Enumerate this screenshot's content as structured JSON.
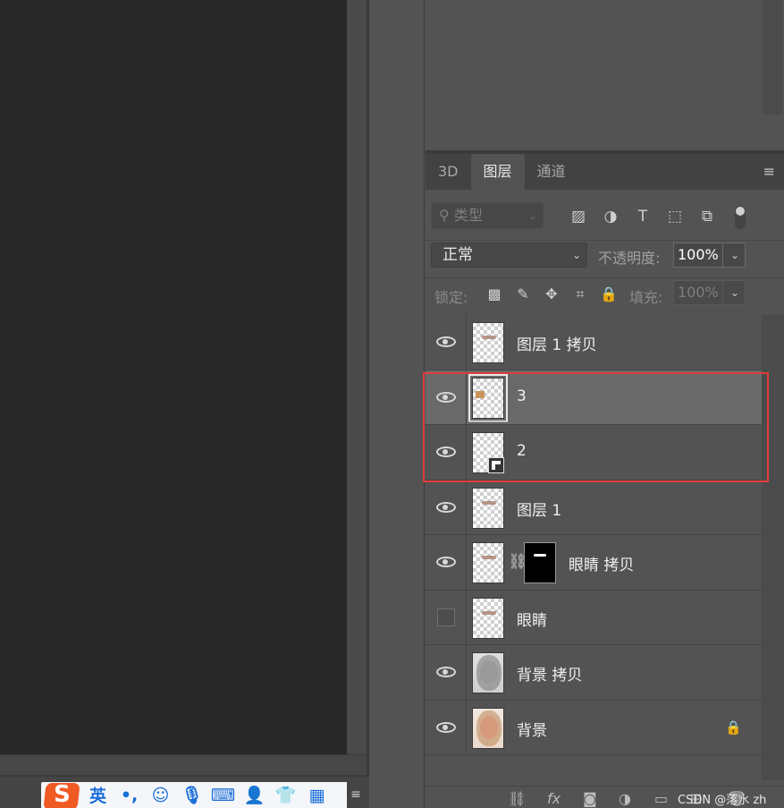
{
  "ime": {
    "logo": "S",
    "mode": "英",
    "punct": "•,",
    "buttons": [
      "emoji-icon",
      "microphone-icon",
      "keyboard-icon",
      "user-icon",
      "skin-icon",
      "toolbox-icon"
    ],
    "menu": "≡"
  },
  "panel": {
    "tabs": [
      "3D",
      "图层",
      "通道"
    ],
    "active_tab": "图层",
    "menu_icon": "≡"
  },
  "filter": {
    "search_label": "类型",
    "icons": [
      "image-filter-icon",
      "adjustment-filter-icon",
      "text-filter-icon",
      "shape-filter-icon",
      "smart-object-filter-icon"
    ]
  },
  "blend": {
    "mode": "正常",
    "opacity_label": "不透明度:",
    "opacity_value": "100%"
  },
  "lock": {
    "label": "锁定:",
    "icons": [
      "lock-transparent-icon",
      "lock-image-icon",
      "lock-position-icon",
      "lock-artboard-icon",
      "lock-all-icon"
    ],
    "fill_label": "填充:",
    "fill_value": "100%"
  },
  "layers": [
    {
      "name": "图层 1 拷贝",
      "visible": true
    },
    {
      "name": "3",
      "visible": true,
      "selected": true
    },
    {
      "name": "2",
      "visible": true,
      "selected": true,
      "smart_object": true
    },
    {
      "name": "图层 1",
      "visible": true
    },
    {
      "name": "眼睛 拷贝",
      "visible": true,
      "mask": true
    },
    {
      "name": "眼睛",
      "visible": false
    },
    {
      "name": "背景 拷贝",
      "visible": true,
      "photo": "bw"
    },
    {
      "name": "背景",
      "visible": true,
      "photo": "color",
      "locked": true
    }
  ],
  "bottom_icons": [
    "link-icon",
    "fx-icon",
    "mask-icon",
    "adjustment-icon",
    "group-icon",
    "new-layer-icon",
    "trash-icon"
  ],
  "watermark": "CSDN @落水 zh",
  "colors": {
    "highlight": "#e03c3c",
    "panel_bg": "#535353",
    "ime_accent": "#1a6fd8",
    "ime_logo": "#f05a23"
  }
}
